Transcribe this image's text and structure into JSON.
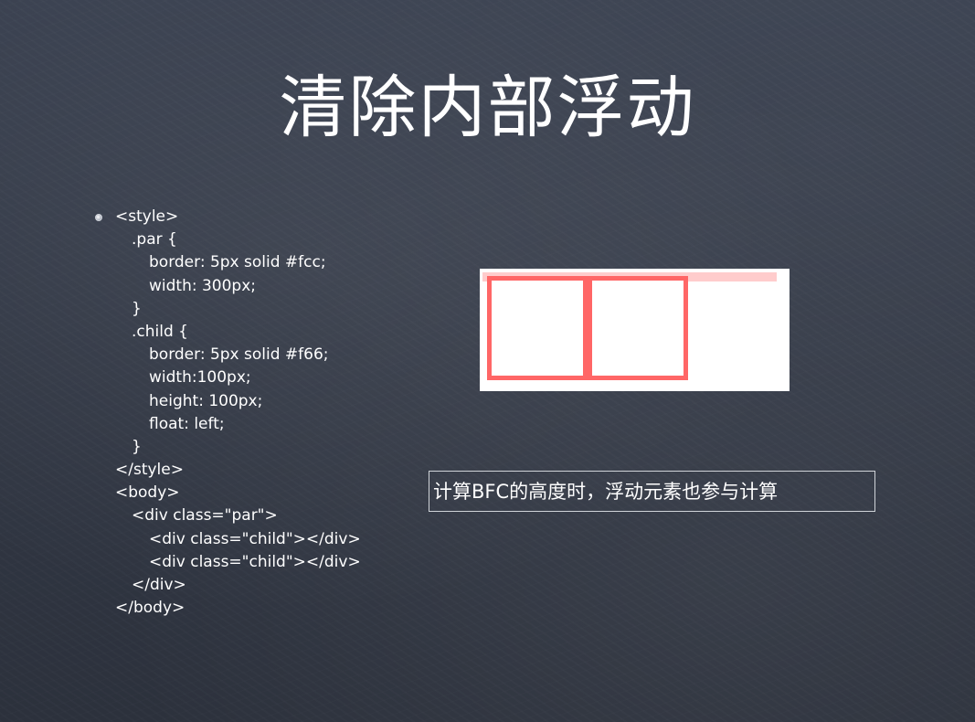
{
  "slide": {
    "title": "清除内部浮动",
    "code_lines": [
      {
        "text": "<style>",
        "indent": 0
      },
      {
        "text": ".par {",
        "indent": 1
      },
      {
        "text": "border: 5px solid #fcc;",
        "indent": 2
      },
      {
        "text": "width: 300px;",
        "indent": 2
      },
      {
        "text": "}",
        "indent": 1
      },
      {
        "text": ".child {",
        "indent": 1
      },
      {
        "text": "border: 5px solid #f66;",
        "indent": 2
      },
      {
        "text": "width:100px;",
        "indent": 2
      },
      {
        "text": "height: 100px;",
        "indent": 2
      },
      {
        "text": "float: left;",
        "indent": 2
      },
      {
        "text": "}",
        "indent": 1
      },
      {
        "text": "</style>",
        "indent": 0
      },
      {
        "text": "<body>",
        "indent": 0
      },
      {
        "text": "<div class=\"par\">",
        "indent": 1
      },
      {
        "text": "<div class=\"child\"></div>",
        "indent": 2
      },
      {
        "text": "<div class=\"child\"></div>",
        "indent": 2
      },
      {
        "text": "</div>",
        "indent": 1
      },
      {
        "text": "</body>",
        "indent": 0
      }
    ],
    "note": "计算BFC的高度时，浮动元素也参与计算"
  },
  "colors": {
    "background": "#343a47",
    "text": "#ffffff",
    "par_border": "#ffcccc",
    "child_border": "#ff6666",
    "demo_background": "#ffffff"
  },
  "icons": {
    "bullet": "bullet-dot-icon"
  }
}
